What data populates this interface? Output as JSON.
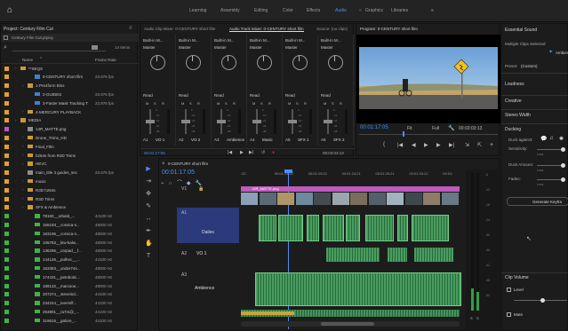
{
  "workspaces": [
    "Learning",
    "Assembly",
    "Editing",
    "Color",
    "Effects",
    "Audio",
    "Graphics",
    "Libraries"
  ],
  "active_workspace": "Audio",
  "more": "»",
  "project": {
    "title": "Project: Century Film Cut",
    "menu": "≡",
    "file": "Century Film Cut.prproj",
    "count": "14 Items",
    "col_name": "Name",
    "col_rate": "Frame Rate",
    "items": [
      {
        "name": "**SEQS",
        "rate": "",
        "color": "#e0a030",
        "indent": 0,
        "type": "folder"
      },
      {
        "name": "0-CENTURY short film",
        "rate": "23.976 fps",
        "color": "#e0a030",
        "indent": 2,
        "type": "seq"
      },
      {
        "name": "1-Pre4form Bins",
        "rate": "",
        "color": "#e0a030",
        "indent": 1,
        "type": "folder"
      },
      {
        "name": "2-GUIDES",
        "rate": "23.976 fps",
        "color": "#e0a030",
        "indent": 2,
        "type": "seq"
      },
      {
        "name": "3-Faster Mask Tracking T",
        "rate": "23.976 fps",
        "color": "#e0a030",
        "indent": 2,
        "type": "seq"
      },
      {
        "name": "4-MERCURY PLAYBACK",
        "rate": "",
        "color": "#e0a030",
        "indent": 1,
        "type": "folder"
      },
      {
        "name": "MEDIA",
        "rate": "",
        "color": "#e0a030",
        "indent": 0,
        "type": "folder"
      },
      {
        "name": "13R_MATTE.png",
        "rate": "",
        "color": "#c455c0",
        "indent": 1,
        "type": "file"
      },
      {
        "name": "Drone_Trims_HD",
        "rate": "",
        "color": "#e0a030",
        "indent": 1,
        "type": "folder"
      },
      {
        "name": "Final_Film",
        "rate": "",
        "color": "#e0a030",
        "indent": 1,
        "type": "folder"
      },
      {
        "name": "h264s from R3D Trims",
        "rate": "",
        "color": "#e0a030",
        "indent": 1,
        "type": "folder"
      },
      {
        "name": "HEVC",
        "rate": "",
        "color": "#e0a030",
        "indent": 1,
        "type": "folder"
      },
      {
        "name": "main_title 3 guides_sec",
        "rate": "23.976 fps",
        "color": "#e0a030",
        "indent": 1,
        "type": "file"
      },
      {
        "name": "music",
        "rate": "",
        "color": "#e0a030",
        "indent": 1,
        "type": "folder"
      },
      {
        "name": "R3D h264s",
        "rate": "",
        "color": "#e0a030",
        "indent": 1,
        "type": "folder"
      },
      {
        "name": "R3D Trims",
        "rate": "",
        "color": "#e0a030",
        "indent": 1,
        "type": "folder"
      },
      {
        "name": "SFX & Ambience",
        "rate": "",
        "color": "#e0a030",
        "indent": 1,
        "type": "folder"
      },
      {
        "name": "79160__orbatit_...",
        "rate": "44100 Hz",
        "color": "#3fb24a",
        "indent": 2,
        "type": "audio"
      },
      {
        "name": "155193__corsica-s...",
        "rate": "48000 Hz",
        "color": "#3fb24a",
        "indent": 2,
        "type": "audio"
      },
      {
        "name": "163195__corsica-s...",
        "rate": "48000 Hz",
        "color": "#3fb24a",
        "indent": 2,
        "type": "audio"
      },
      {
        "name": "106783__kiw-kalw...",
        "rate": "48000 Hz",
        "color": "#3fb24a",
        "indent": 2,
        "type": "audio"
      },
      {
        "name": "136296__carpad__f...",
        "rate": "48000 Hz",
        "color": "#3fb24a",
        "indent": 2,
        "type": "audio"
      },
      {
        "name": "144126__pulhec__...",
        "rate": "44100 Hz",
        "color": "#3fb24a",
        "indent": 2,
        "type": "audio"
      },
      {
        "name": "163383__under74s...",
        "rate": "48000 Hz",
        "color": "#3fb24a",
        "indent": 2,
        "type": "audio"
      },
      {
        "name": "174431__petobotic...",
        "rate": "48000 Hz",
        "color": "#3fb24a",
        "indent": 2,
        "type": "audio"
      },
      {
        "name": "189132__marcsoe...",
        "rate": "48000 Hz",
        "color": "#3fb24a",
        "indent": 2,
        "type": "audio"
      },
      {
        "name": "207274__steveind...",
        "rate": "44100 Hz",
        "color": "#3fb24a",
        "indent": 2,
        "type": "audio"
      },
      {
        "name": "234244__tvermilf...",
        "rate": "44100 Hz",
        "color": "#3fb24a",
        "indent": 2,
        "type": "audio"
      },
      {
        "name": "253901__ra7m@_...",
        "rate": "44100 Hz",
        "color": "#3fb24a",
        "indent": 2,
        "type": "audio"
      },
      {
        "name": "319616__galore_...",
        "rate": "44100 Hz",
        "color": "#3fb24a",
        "indent": 2,
        "type": "audio"
      }
    ]
  },
  "mixer": {
    "tabs": [
      "Audio Clip Mixer: 0-CENTURY short film",
      "Audio Track Mixer: 0-CENTURY short film",
      "Source: (no clips)"
    ],
    "active_tab": 1,
    "input": "Built-in M...",
    "output": "Master",
    "mode": "Read",
    "msr": [
      "M",
      "S",
      "R"
    ],
    "channels": [
      {
        "track": "A1",
        "name": "VO 1"
      },
      {
        "track": "A2",
        "name": "VO 2"
      },
      {
        "track": "A3",
        "name": "Ambience"
      },
      {
        "track": "A4",
        "name": "Music"
      },
      {
        "track": "A5",
        "name": "SFX 1"
      },
      {
        "track": "A6",
        "name": "SFX 2"
      }
    ],
    "scale": [
      "0",
      "-6",
      "-12",
      "-18",
      "-24",
      "-30",
      "-36",
      "-42",
      "-48",
      "-54"
    ],
    "tc_left": "00:01:17:05",
    "tc_right": "00:03:03:13"
  },
  "program": {
    "title": "Program: 0-CENTURY short film",
    "menu": "≡",
    "timecode": "00:01:17:05",
    "fit": "Fit",
    "quality": "Full",
    "duration": "00:03:03:13"
  },
  "timeline": {
    "title": "0-CENTURY short film",
    "menu": "≡",
    "timecode": "00:01:17:05",
    "ruler": [
      ":22",
      "00:01:14:22",
      "00:01:19:22",
      "00:01:24:21",
      "00:01:29:21",
      "00:01:34:21",
      "00:01:"
    ],
    "tracks": [
      {
        "id": "V1",
        "name": ""
      },
      {
        "id": "A1",
        "name": "Dailes"
      },
      {
        "id": "A2",
        "name": "VO 1"
      },
      {
        "id": "A3",
        "name": "Ambience"
      }
    ],
    "clip_label": "13R_MATTE.png",
    "meter_scale": [
      "-6",
      "-12",
      "-18",
      "-24",
      "-30",
      "-36",
      "-42",
      "-48",
      "-54"
    ],
    "meter_sr": [
      "S",
      "S"
    ]
  },
  "essential": {
    "title": "Essential Sound",
    "menu": "≡",
    "multi": "Multiple Clips Selected",
    "type": "Ambience",
    "preset_label": "Preset:",
    "preset_value": "(Custom)",
    "sections": [
      "Loudness",
      "Creative",
      "Stereo Width",
      "Ducking"
    ],
    "duck_against": "Duck against:",
    "sensitivity": "Sensitivity:",
    "duck_amount": "Duck Amount:",
    "fades": "Fades:",
    "fewer_more": [
      "Less",
      "More"
    ],
    "generate": "Generate Keyfra",
    "clip_volume": "Clip Volume",
    "level": "Level",
    "mute": "Mute"
  }
}
